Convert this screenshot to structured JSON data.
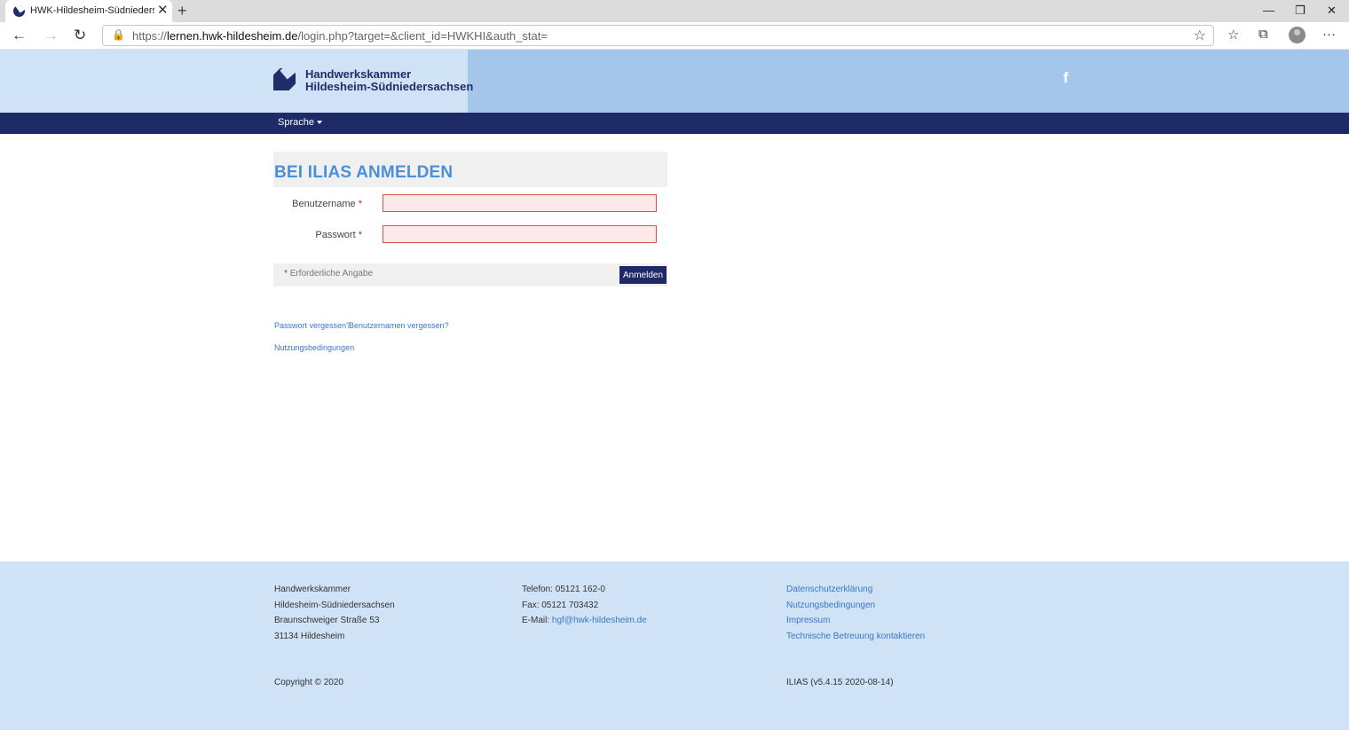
{
  "browser": {
    "tab_title": "HWK-Hildesheim-Südniedersachsen",
    "tab_close": "✕",
    "new_tab": "+",
    "window": {
      "minimize": "—",
      "restore": "❐",
      "close": "✕"
    },
    "nav": {
      "back": "←",
      "forward": "→",
      "reload": "↻"
    },
    "url_prefix": "https://",
    "url_host": "lernen.hwk-hildesheim.de",
    "url_rest": "/login.php?target=&client_id=HWKHI&auth_stat=",
    "lock_icon": "🔒",
    "star_icon": "☆",
    "toolbar_icons": {
      "favorites": "☆",
      "collections": "⧉",
      "menu": "···"
    }
  },
  "header": {
    "logo_line1": "Handwerkskammer",
    "logo_line2": "Hildesheim-Südniedersachsen",
    "facebook": "f"
  },
  "navbar": {
    "language_label": "Sprache"
  },
  "login": {
    "title": "BEI ILIAS ANMELDEN",
    "username_label": "Benutzername",
    "password_label": "Passwort",
    "required_marker": "*",
    "required_note": "Erforderliche Angabe",
    "submit_label": "Anmelden",
    "username_value": "",
    "password_value": ""
  },
  "links": {
    "forgot_password": "Passwort vergessen?",
    "forgot_username": "Benutzernamen vergessen?",
    "terms": "Nutzungsbedingungen"
  },
  "footer": {
    "address": [
      "Handwerkskammer",
      "Hildesheim-Südniedersachsen",
      "Braunschweiger Straße 53",
      "31134 Hildesheim"
    ],
    "phone": "Telefon: 05121 162-0",
    "fax": "Fax: 05121 703432",
    "email_label": "E-Mail: ",
    "email": "hgf@hwk-hildesheim.de",
    "links": [
      "Datenschutzerklärung",
      "Nutzungsbedingungen",
      "Impressum",
      "Technische Betreuung kontaktieren"
    ],
    "copyright": "Copyright © 2020",
    "version": "ILIAS (v5.4.15 2020-08-14)"
  },
  "colors": {
    "navy": "#1d2a66",
    "header_light": "#d0e2f5",
    "header_mid": "#a4c6eb",
    "title_blue": "#4a90d9",
    "link_blue": "#3a78c3"
  }
}
